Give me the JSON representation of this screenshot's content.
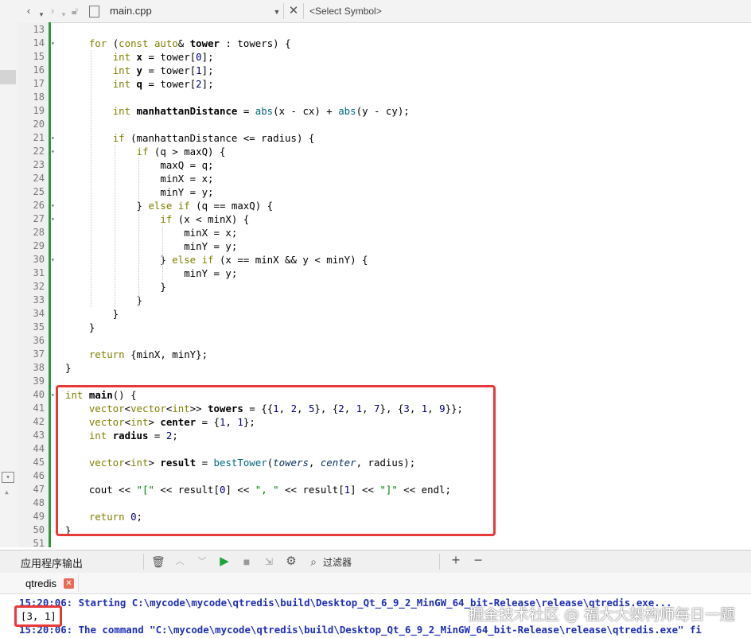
{
  "toolbar": {
    "file_name": "main.cpp",
    "symbol_placeholder": "<Select Symbol>"
  },
  "editor": {
    "lines": [
      {
        "n": "13",
        "fold": ""
      },
      {
        "n": "14",
        "fold": "▾"
      },
      {
        "n": "15",
        "fold": ""
      },
      {
        "n": "16",
        "fold": ""
      },
      {
        "n": "17",
        "fold": ""
      },
      {
        "n": "18",
        "fold": ""
      },
      {
        "n": "19",
        "fold": ""
      },
      {
        "n": "20",
        "fold": ""
      },
      {
        "n": "21",
        "fold": "▾"
      },
      {
        "n": "22",
        "fold": "▾"
      },
      {
        "n": "23",
        "fold": ""
      },
      {
        "n": "24",
        "fold": ""
      },
      {
        "n": "25",
        "fold": ""
      },
      {
        "n": "26",
        "fold": "▾"
      },
      {
        "n": "27",
        "fold": "▾"
      },
      {
        "n": "28",
        "fold": ""
      },
      {
        "n": "29",
        "fold": ""
      },
      {
        "n": "30",
        "fold": "▾"
      },
      {
        "n": "31",
        "fold": ""
      },
      {
        "n": "32",
        "fold": ""
      },
      {
        "n": "33",
        "fold": ""
      },
      {
        "n": "34",
        "fold": ""
      },
      {
        "n": "35",
        "fold": ""
      },
      {
        "n": "36",
        "fold": ""
      },
      {
        "n": "37",
        "fold": ""
      },
      {
        "n": "38",
        "fold": ""
      },
      {
        "n": "39",
        "fold": ""
      },
      {
        "n": "40",
        "fold": "▾"
      },
      {
        "n": "41",
        "fold": ""
      },
      {
        "n": "42",
        "fold": ""
      },
      {
        "n": "43",
        "fold": ""
      },
      {
        "n": "44",
        "fold": ""
      },
      {
        "n": "45",
        "fold": ""
      },
      {
        "n": "46",
        "fold": ""
      },
      {
        "n": "47",
        "fold": ""
      },
      {
        "n": "48",
        "fold": ""
      },
      {
        "n": "49",
        "fold": ""
      },
      {
        "n": "50",
        "fold": ""
      },
      {
        "n": "51",
        "fold": ""
      }
    ],
    "code": [
      [],
      [
        [
          "    ",
          ""
        ],
        [
          "for",
          "kw"
        ],
        [
          " (",
          ""
        ],
        [
          "const",
          "kw"
        ],
        [
          " ",
          ""
        ],
        [
          "auto",
          "kw"
        ],
        [
          "& ",
          ""
        ],
        [
          "tower",
          "b"
        ],
        [
          " : towers) {",
          ""
        ]
      ],
      [
        [
          "        ",
          ""
        ],
        [
          "int",
          "kw"
        ],
        [
          " ",
          ""
        ],
        [
          "x",
          "b"
        ],
        [
          " = tower[",
          ""
        ],
        [
          "0",
          "num"
        ],
        [
          "];",
          ""
        ]
      ],
      [
        [
          "        ",
          ""
        ],
        [
          "int",
          "kw"
        ],
        [
          " ",
          ""
        ],
        [
          "y",
          "b"
        ],
        [
          " = tower[",
          ""
        ],
        [
          "1",
          "num"
        ],
        [
          "];",
          ""
        ]
      ],
      [
        [
          "        ",
          ""
        ],
        [
          "int",
          "kw"
        ],
        [
          " ",
          ""
        ],
        [
          "q",
          "b"
        ],
        [
          " = tower[",
          ""
        ],
        [
          "2",
          "num"
        ],
        [
          "];",
          ""
        ]
      ],
      [],
      [
        [
          "        ",
          ""
        ],
        [
          "int",
          "kw"
        ],
        [
          " ",
          ""
        ],
        [
          "manhattanDistance",
          "b"
        ],
        [
          " = ",
          ""
        ],
        [
          "abs",
          "fn"
        ],
        [
          "(x - cx) + ",
          ""
        ],
        [
          "abs",
          "fn"
        ],
        [
          "(y - cy);",
          ""
        ]
      ],
      [],
      [
        [
          "        ",
          ""
        ],
        [
          "if",
          "kw"
        ],
        [
          " (manhattanDistance <= radius) {",
          ""
        ]
      ],
      [
        [
          "            ",
          ""
        ],
        [
          "if",
          "kw"
        ],
        [
          " (q > maxQ) {",
          ""
        ]
      ],
      [
        [
          "                maxQ = q;",
          ""
        ]
      ],
      [
        [
          "                minX = x;",
          ""
        ]
      ],
      [
        [
          "                minY = y;",
          ""
        ]
      ],
      [
        [
          "            } ",
          ""
        ],
        [
          "else",
          "kw"
        ],
        [
          " ",
          ""
        ],
        [
          "if",
          "kw"
        ],
        [
          " (q == maxQ) {",
          ""
        ]
      ],
      [
        [
          "                ",
          ""
        ],
        [
          "if",
          "kw"
        ],
        [
          " (x < minX) {",
          ""
        ]
      ],
      [
        [
          "                    minX = x;",
          ""
        ]
      ],
      [
        [
          "                    minY = y;",
          ""
        ]
      ],
      [
        [
          "                } ",
          ""
        ],
        [
          "else",
          "kw"
        ],
        [
          " ",
          ""
        ],
        [
          "if",
          "kw"
        ],
        [
          " (x == minX && y < minY) {",
          ""
        ]
      ],
      [
        [
          "                    minY = y;",
          ""
        ]
      ],
      [
        [
          "                }",
          ""
        ]
      ],
      [
        [
          "            }",
          ""
        ]
      ],
      [
        [
          "        }",
          ""
        ]
      ],
      [
        [
          "    }",
          ""
        ]
      ],
      [],
      [
        [
          "    ",
          ""
        ],
        [
          "return",
          "kw"
        ],
        [
          " {minX, minY};",
          ""
        ]
      ],
      [
        [
          "}",
          ""
        ]
      ],
      [],
      [
        [
          "int",
          "kw"
        ],
        [
          " ",
          ""
        ],
        [
          "main",
          "b"
        ],
        [
          "() {",
          ""
        ]
      ],
      [
        [
          "    ",
          ""
        ],
        [
          "vector",
          "kw"
        ],
        [
          "<",
          ""
        ],
        [
          "vector",
          "kw"
        ],
        [
          "<",
          ""
        ],
        [
          "int",
          "kw"
        ],
        [
          ">> ",
          ""
        ],
        [
          "towers",
          "b"
        ],
        [
          " = {{",
          ""
        ],
        [
          "1",
          "num"
        ],
        [
          ", ",
          ""
        ],
        [
          "2",
          "num"
        ],
        [
          ", ",
          ""
        ],
        [
          "5",
          "num"
        ],
        [
          "}, {",
          ""
        ],
        [
          "2",
          "num"
        ],
        [
          ", ",
          ""
        ],
        [
          "1",
          "num"
        ],
        [
          ", ",
          ""
        ],
        [
          "7",
          "num"
        ],
        [
          "}, {",
          ""
        ],
        [
          "3",
          "num"
        ],
        [
          ", ",
          ""
        ],
        [
          "1",
          "num"
        ],
        [
          ", ",
          ""
        ],
        [
          "9",
          "num"
        ],
        [
          "}};",
          ""
        ]
      ],
      [
        [
          "    ",
          ""
        ],
        [
          "vector",
          "kw"
        ],
        [
          "<",
          ""
        ],
        [
          "int",
          "kw"
        ],
        [
          "> ",
          ""
        ],
        [
          "center",
          "b"
        ],
        [
          " = {",
          ""
        ],
        [
          "1",
          "num"
        ],
        [
          ", ",
          ""
        ],
        [
          "1",
          "num"
        ],
        [
          "};",
          ""
        ]
      ],
      [
        [
          "    ",
          ""
        ],
        [
          "int",
          "kw"
        ],
        [
          " ",
          ""
        ],
        [
          "radius",
          "b"
        ],
        [
          " = ",
          ""
        ],
        [
          "2",
          "num"
        ],
        [
          ";",
          ""
        ]
      ],
      [],
      [
        [
          "    ",
          ""
        ],
        [
          "vector",
          "kw"
        ],
        [
          "<",
          ""
        ],
        [
          "int",
          "kw"
        ],
        [
          "> ",
          ""
        ],
        [
          "result",
          "b"
        ],
        [
          " = ",
          ""
        ],
        [
          "bestTower",
          "fn"
        ],
        [
          "(",
          ""
        ],
        [
          "towers",
          "it"
        ],
        [
          ", ",
          ""
        ],
        [
          "center",
          "it"
        ],
        [
          ", radius);",
          ""
        ]
      ],
      [],
      [
        [
          "    cout << ",
          ""
        ],
        [
          "\"[\"",
          "str"
        ],
        [
          " << result[",
          ""
        ],
        [
          "0",
          "num"
        ],
        [
          "] << ",
          ""
        ],
        [
          "\", \"",
          "str"
        ],
        [
          " << result[",
          ""
        ],
        [
          "1",
          "num"
        ],
        [
          "] << ",
          ""
        ],
        [
          "\"]\"",
          "str"
        ],
        [
          " << endl;",
          ""
        ]
      ],
      [],
      [
        [
          "    ",
          ""
        ],
        [
          "return",
          "kw"
        ],
        [
          " ",
          ""
        ],
        [
          "0",
          "num"
        ],
        [
          ";",
          ""
        ]
      ],
      [
        [
          "}",
          ""
        ]
      ],
      []
    ]
  },
  "output_panel": {
    "title": "应用程序输出",
    "filter_placeholder": "过滤器",
    "tab_label": "qtredis",
    "lines": [
      "15:20:06: Starting C:\\mycode\\mycode\\qtredis\\build\\Desktop_Qt_6_9_2_MinGW_64_bit-Release\\release\\qtredis.exe...",
      "[3, 1]",
      "15:20:06: The command \"C:\\mycode\\mycode\\qtredis\\build\\Desktop_Qt_6_9_2_MinGW_64_bit-Release\\release\\qtredis.exe\" fi"
    ]
  },
  "watermark": "掘金技术社区 @ 福大大架构师每日一题",
  "colors": {
    "highlight_box": "#e8393a",
    "change_bar": "#2b9a3d",
    "output_message": "#1d2fb5",
    "keyword": "#808000"
  }
}
